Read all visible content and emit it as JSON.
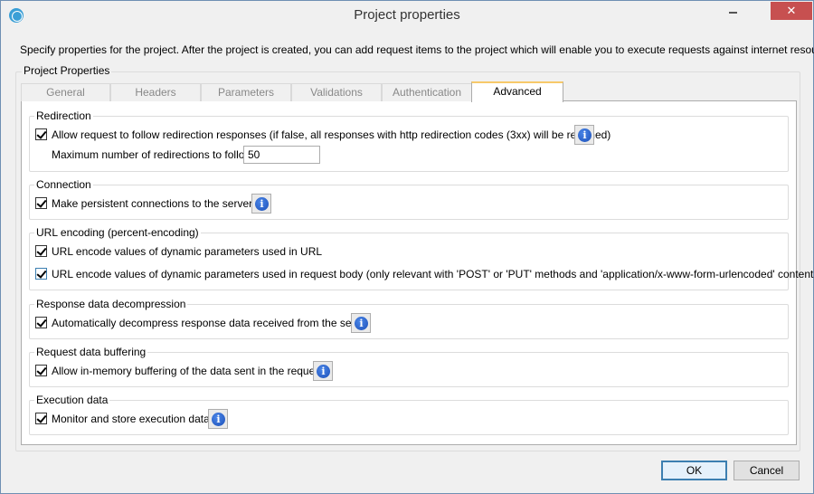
{
  "window": {
    "title": "Project properties",
    "close_glyph": "✕"
  },
  "intro_text": "Specify properties for the project. After the project is created, you can add request items to the project which will enable you to execute requests against internet resources.",
  "group_label": "Project Properties",
  "tabs": [
    {
      "label": "General",
      "active": false
    },
    {
      "label": "Headers",
      "active": false
    },
    {
      "label": "Parameters",
      "active": false
    },
    {
      "label": "Validations",
      "active": false
    },
    {
      "label": "Authentication",
      "active": false
    },
    {
      "label": "Advanced",
      "active": true
    }
  ],
  "sections": {
    "redirection": {
      "title": "Redirection",
      "follow_label": "Allow request to follow redirection responses (if false, all responses with http redirection codes (3xx) will be returned)",
      "follow_checked": true,
      "max_label": "Maximum number of redirections to follow:",
      "max_value": "50"
    },
    "connection": {
      "title": "Connection",
      "persistent_label": "Make persistent connections to the servers",
      "persistent_checked": true
    },
    "url_encoding": {
      "title": "URL encoding (percent-encoding)",
      "url_label": "URL encode values of dynamic parameters used in URL",
      "url_checked": true,
      "body_label": "URL encode values of dynamic parameters used in request body (only relevant with 'POST' or 'PUT' methods and 'application/x-www-form-urlencoded' content type)",
      "body_checked": true
    },
    "decompression": {
      "title": "Response data decompression",
      "decompress_label": "Automatically decompress response data received from the server",
      "decompress_checked": true
    },
    "buffering": {
      "title": "Request data buffering",
      "buffer_label": "Allow in-memory buffering of the data sent in the request",
      "buffer_checked": true
    },
    "execution": {
      "title": "Execution data",
      "monitor_label": "Monitor and store execution data",
      "monitor_checked": true
    }
  },
  "info_glyph": "i",
  "buttons": {
    "ok": "OK",
    "cancel": "Cancel"
  },
  "colors": {
    "active_tab_accent": "#f7c96a",
    "close_button": "#c75050",
    "info_icon": "#1c4fb8"
  }
}
